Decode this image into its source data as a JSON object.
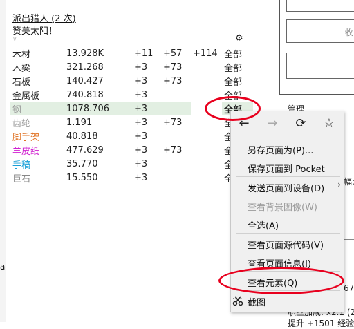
{
  "left_strip": {
    "fragment": "al"
  },
  "header": {
    "line1": "派出猎人 (2 次)",
    "line2": "赞美太阳！",
    "arrow": "∨",
    "gear_icon": "gear-icon"
  },
  "resources": [
    {
      "name": "木材",
      "value": "13.928K",
      "p1": "+11",
      "p2": "+57",
      "p3": "+114",
      "all": "全部",
      "color": "#222222"
    },
    {
      "name": "木梁",
      "value": "321.268",
      "p1": "+3",
      "p2": "+73",
      "p3": "",
      "all": "全部",
      "color": "#222222"
    },
    {
      "name": "石板",
      "value": "140.427",
      "p1": "+3",
      "p2": "+73",
      "p3": "",
      "all": "全部",
      "color": "#222222"
    },
    {
      "name": "金属板",
      "value": "740.818",
      "p1": "+3",
      "p2": "",
      "p3": "",
      "all": "全部",
      "color": "#222222"
    },
    {
      "name": "钢",
      "value": "1078.706",
      "p1": "+3",
      "p2": "",
      "p3": "",
      "all": "全部",
      "color": "#999999"
    },
    {
      "name": "齿轮",
      "value": "1.191",
      "p1": "+3",
      "p2": "+73",
      "p3": "",
      "all": "全",
      "color": "#999999"
    },
    {
      "name": "脚手架",
      "value": "40.818",
      "p1": "+3",
      "p2": "",
      "p3": "",
      "all": "全",
      "color": "#e07020"
    },
    {
      "name": "羊皮纸",
      "value": "477.629",
      "p1": "+3",
      "p2": "+73",
      "p3": "",
      "all": "全",
      "color": "#d020d0"
    },
    {
      "name": "手稿",
      "value": "35.770",
      "p1": "+3",
      "p2": "",
      "p3": "",
      "all": "全",
      "color": "#1aa0d8"
    },
    {
      "name": "巨石",
      "value": "15.550",
      "p1": "+3",
      "p2": "",
      "p3": "",
      "all": "全",
      "color": "#888888"
    }
  ],
  "right_panel": {
    "collect_fragment": "牧",
    "manage_label": "管理",
    "fragment_fu": "幅:",
    "fragment_67": "67",
    "bonus": "职业加成: x2.1 (2",
    "cut": "提升 +1501 经验"
  },
  "context_menu": {
    "nav": {
      "back_icon": "←",
      "forward_icon": "→",
      "reload_icon": "⟳",
      "bookmark_icon": "☆"
    },
    "items": [
      {
        "label": "另存页面为(P)...",
        "disabled": false
      },
      {
        "label": "保存页面到 Pocket",
        "disabled": false
      },
      {
        "label": "发送页面到设备(D)",
        "disabled": false,
        "submenu": "›"
      },
      {
        "label": "查看背景图像(W)",
        "disabled": true
      },
      {
        "label": "全选(A)",
        "disabled": false
      },
      {
        "label": "查看页面源代码(V)",
        "disabled": false
      },
      {
        "label": "查看页面信息(I)",
        "disabled": false
      },
      {
        "label": "查看元素(Q)",
        "disabled": false
      },
      {
        "label": "截图",
        "disabled": false,
        "icon": "scissors-icon"
      }
    ]
  },
  "highlight_color": "#e8001e"
}
